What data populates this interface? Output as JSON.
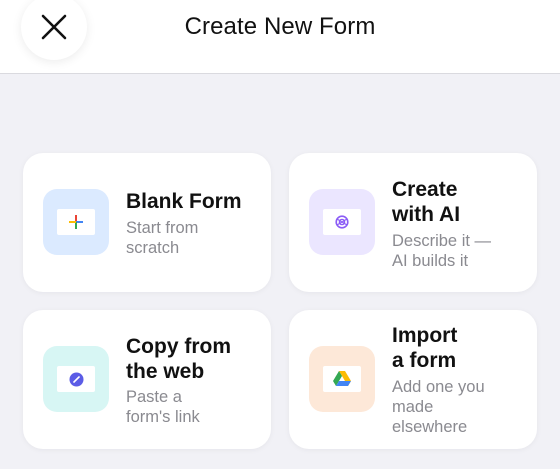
{
  "header": {
    "title": "Create New Form",
    "close_icon": "close-icon"
  },
  "options": [
    {
      "title_lines": [
        "Blank Form"
      ],
      "subtitle_lines": [
        "Start from",
        "scratch"
      ],
      "icon": "plus-icon",
      "tile_color": "#dbeaff"
    },
    {
      "title_lines": [
        "Create",
        "with AI"
      ],
      "subtitle_lines": [
        "Describe it —",
        "AI builds it"
      ],
      "icon": "ai-sparkle-icon",
      "tile_color": "#ebe6ff"
    },
    {
      "title_lines": [
        "Copy from",
        "the web"
      ],
      "subtitle_lines": [
        "Paste a",
        "form's link"
      ],
      "icon": "link-icon",
      "tile_color": "#d7f6f4"
    },
    {
      "title_lines": [
        "Import",
        "a form"
      ],
      "subtitle_lines": [
        "Add one you",
        "made",
        "elsewhere"
      ],
      "icon": "google-drive-icon",
      "tile_color": "#fde8d8"
    }
  ]
}
